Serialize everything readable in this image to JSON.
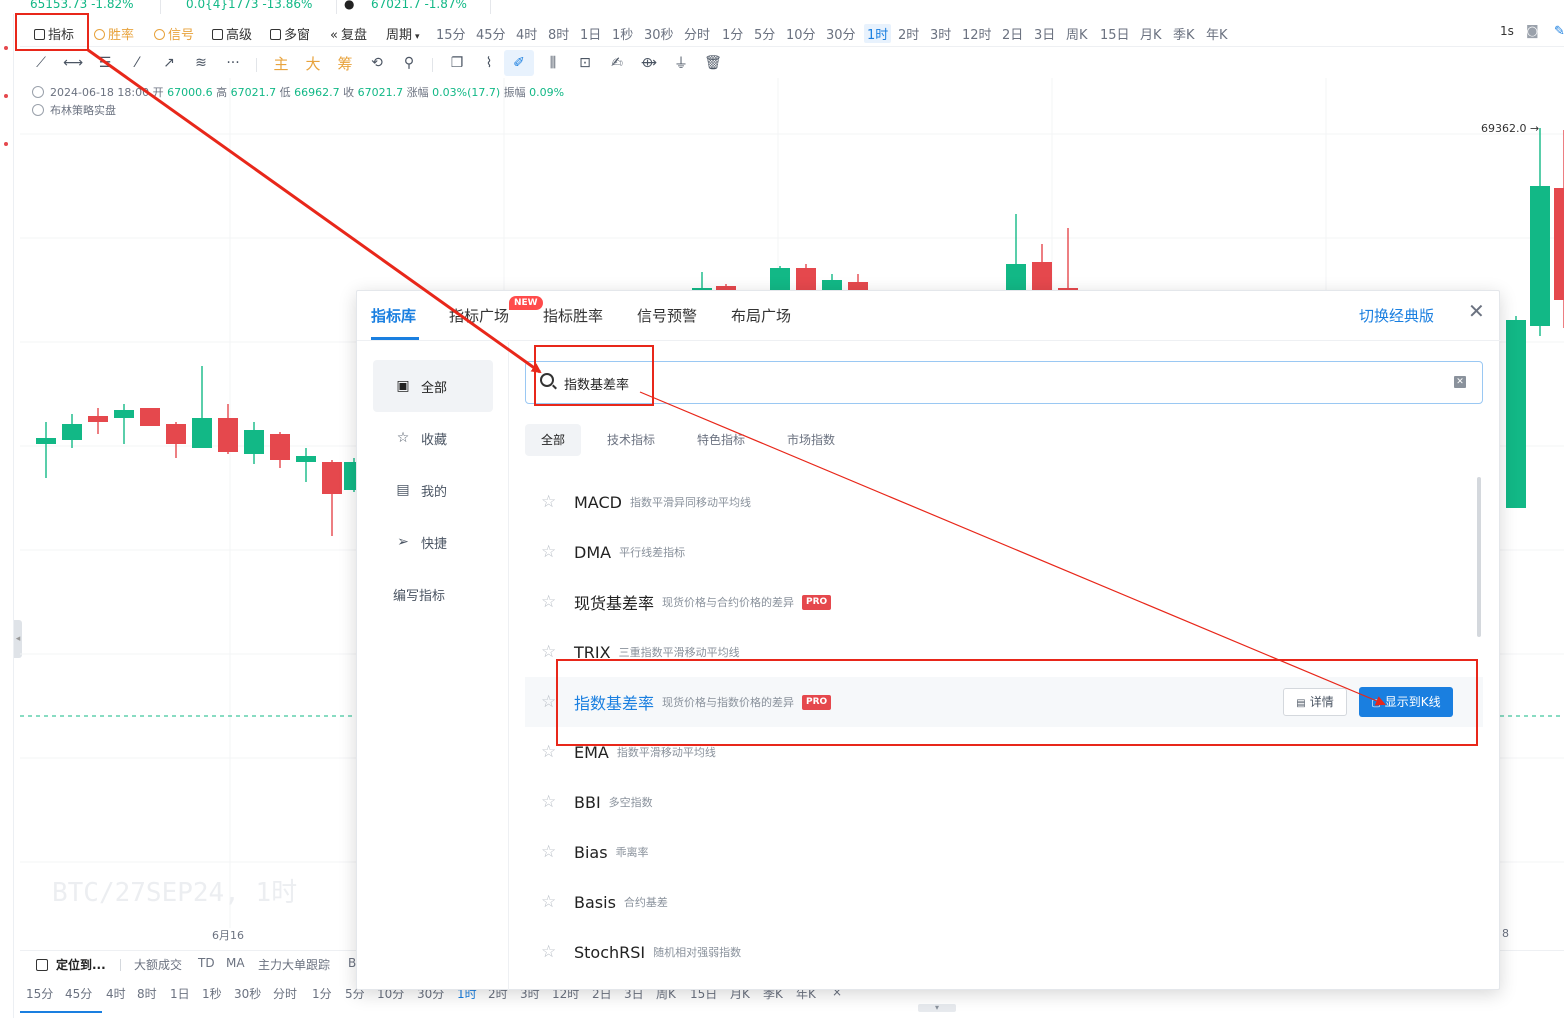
{
  "ticker": [
    {
      "text": "65153.73 -1.82%"
    },
    {
      "text": "0.0{4}1773 -13.86%"
    },
    {
      "text": "67021.7 -1.87%"
    }
  ],
  "toolbar": {
    "indicator_label": "指标",
    "winrate_label": "胜率",
    "signal_label": "信号",
    "advanced_label": "高级",
    "multiwindow_label": "多窗",
    "replay_label": "复盘",
    "period_label": "周期",
    "periods": [
      "15分",
      "45分",
      "4时",
      "8时",
      "1日",
      "1秒",
      "30秒",
      "分时",
      "1分",
      "5分",
      "10分",
      "30分",
      "1时",
      "2时",
      "3时",
      "12时",
      "2日",
      "3日",
      "周K",
      "15日",
      "月K",
      "季K",
      "年K"
    ],
    "active_period": "1时",
    "interval_right": "1s"
  },
  "drawing_tools": {
    "main_label": "主",
    "big_label": "大",
    "chip_label": "筹",
    "more": "···"
  },
  "ohlc": {
    "datetime": "2024-06-18 18:00",
    "open_label": "开",
    "open": "67000.6",
    "high_label": "高",
    "high": "67021.7",
    "low_label": "低",
    "low": "66962.7",
    "close_label": "收",
    "close": "67021.7",
    "change_label": "涨幅",
    "change": "0.03%(17.7)",
    "amplitude_label": "振幅",
    "amplitude": "0.09%",
    "strategy": "布林策略实盘"
  },
  "chart": {
    "price_tag": "69362.0",
    "watermark": "BTC/27SEP24, 1时",
    "date_label": "6月16",
    "date_label_right": "8",
    "up_color": "#12b886",
    "down_color": "#e5484d"
  },
  "bottom_bar": {
    "locate_label": "定位到...",
    "items": [
      "大额成交",
      "TD",
      "MA",
      "主力大单跟踪",
      "B"
    ]
  },
  "bottom_periods": {
    "items": [
      "15分",
      "45分",
      "4时",
      "8时",
      "1日",
      "1秒",
      "30秒",
      "分时",
      "1分",
      "5分",
      "10分",
      "30分",
      "1时",
      "2时",
      "3时",
      "12时",
      "2日",
      "3日",
      "周K",
      "15日",
      "月K",
      "季K",
      "年K"
    ],
    "active": "1时"
  },
  "modal": {
    "tabs": [
      "指标库",
      "指标广场",
      "指标胜率",
      "信号预警",
      "布局广场"
    ],
    "active_tab": "指标库",
    "new_badge": "NEW",
    "switch_label": "切换经典版",
    "close": "✕",
    "sidebar": [
      "全部",
      "收藏",
      "我的",
      "快捷",
      "编写指标"
    ],
    "search": {
      "value": "指数基差率"
    },
    "categories": [
      "全部",
      "技术指标",
      "特色指标",
      "市场指数"
    ],
    "list": [
      {
        "name": "MACD",
        "desc": "指数平滑异同移动平均线",
        "pro": false
      },
      {
        "name": "DMA",
        "desc": "平行线差指标",
        "pro": false
      },
      {
        "name": "现货基差率",
        "desc": "现货价格与合约价格的差异",
        "pro": true
      },
      {
        "name": "TRIX",
        "desc": "三重指数平滑移动平均线",
        "pro": false
      },
      {
        "name": "指数基差率",
        "desc": "现货价格与指数价格的差异",
        "pro": true
      },
      {
        "name": "EMA",
        "desc": "指数平滑移动平均线",
        "pro": false
      },
      {
        "name": "BBI",
        "desc": "多空指数",
        "pro": false
      },
      {
        "name": "Bias",
        "desc": "乖离率",
        "pro": false
      },
      {
        "name": "Basis",
        "desc": "合约基差",
        "pro": false
      },
      {
        "name": "StochRSI",
        "desc": "随机相对强弱指数",
        "pro": false
      }
    ],
    "pro_label": "PRO",
    "detail_button": "详情",
    "show_button": "显示到K线"
  }
}
